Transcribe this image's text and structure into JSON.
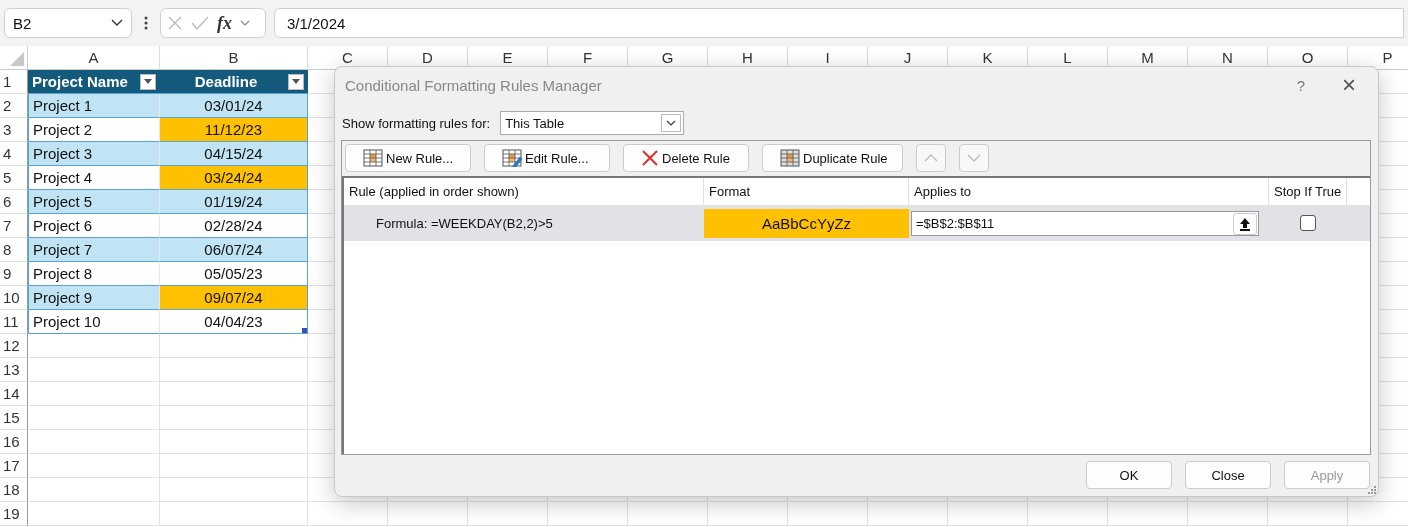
{
  "formula_bar": {
    "name_box": "B2",
    "fx": "fx",
    "formula": "3/1/2024"
  },
  "sheet": {
    "columns": [
      "A",
      "B",
      "C",
      "D",
      "E",
      "F",
      "G",
      "H",
      "I",
      "J",
      "K",
      "L",
      "M",
      "N",
      "O",
      "P"
    ],
    "row_numbers": [
      "1",
      "2",
      "3",
      "4",
      "5",
      "6",
      "7",
      "8",
      "9",
      "10",
      "11",
      "12",
      "13",
      "14",
      "15",
      "16",
      "17",
      "18",
      "19"
    ],
    "table_headers": [
      "Project Name",
      "Deadline"
    ],
    "rows": [
      {
        "name": "Project 1",
        "deadline": "03/01/24",
        "highlighted": false
      },
      {
        "name": "Project 2",
        "deadline": "11/12/23",
        "highlighted": true
      },
      {
        "name": "Project 3",
        "deadline": "04/15/24",
        "highlighted": false
      },
      {
        "name": "Project 4",
        "deadline": "03/24/24",
        "highlighted": true
      },
      {
        "name": "Project 5",
        "deadline": "01/19/24",
        "highlighted": false
      },
      {
        "name": "Project 6",
        "deadline": "02/28/24",
        "highlighted": false
      },
      {
        "name": "Project 7",
        "deadline": "06/07/24",
        "highlighted": false
      },
      {
        "name": "Project 8",
        "deadline": "05/05/23",
        "highlighted": false
      },
      {
        "name": "Project 9",
        "deadline": "09/07/24",
        "highlighted": true
      },
      {
        "name": "Project 10",
        "deadline": "04/04/23",
        "highlighted": false
      }
    ]
  },
  "dialog": {
    "title": "Conditional Formatting Rules Manager",
    "help": "?",
    "close": "×",
    "show_label": "Show formatting rules for:",
    "show_value": "This Table",
    "toolbar": [
      {
        "kind": "new",
        "label": "New Rule...",
        "disabled": false
      },
      {
        "kind": "edit",
        "label": "Edit Rule...",
        "disabled": false
      },
      {
        "kind": "delete",
        "label": "Delete Rule",
        "disabled": false
      },
      {
        "kind": "duplicate",
        "label": "Duplicate Rule",
        "disabled": false
      },
      {
        "kind": "up",
        "disabled": true
      },
      {
        "kind": "down",
        "disabled": true
      }
    ],
    "columns": [
      "Rule (applied in order shown)",
      "Format",
      "Applies to",
      "Stop If True"
    ],
    "rules": [
      {
        "rule": "Formula: =WEEKDAY(B2,2)>5",
        "format_preview": "AaBbCcYyZz",
        "color": "#ffc000",
        "applies_to": "=$B$2:$B$11",
        "stop_if_true": false,
        "selected": true
      }
    ],
    "buttons": [
      {
        "label": "OK",
        "disabled": false
      },
      {
        "label": "Close",
        "disabled": false
      },
      {
        "label": "Apply",
        "disabled": true
      }
    ]
  }
}
